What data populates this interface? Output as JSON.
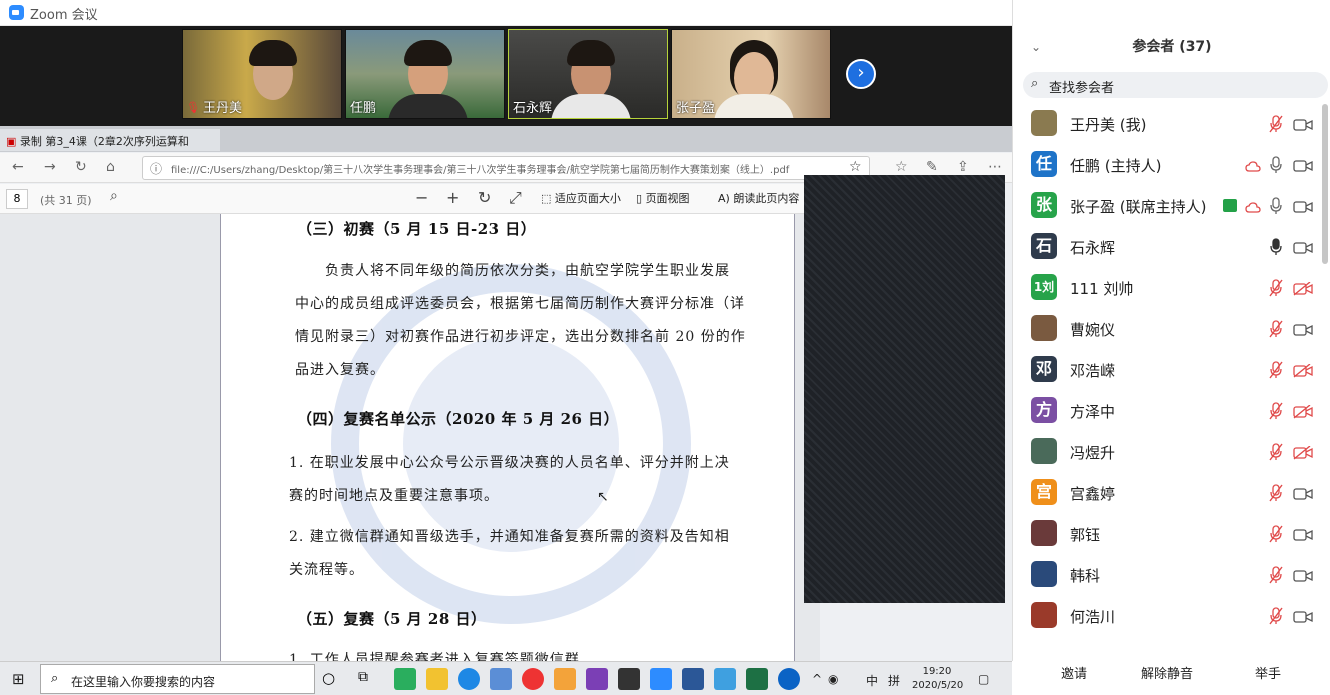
{
  "window": {
    "title": "Zoom 会议"
  },
  "videos": [
    {
      "name": "王丹美",
      "muted": true
    },
    {
      "name": "任鹏",
      "muted": false
    },
    {
      "name": "石永辉",
      "muted": false
    },
    {
      "name": "张子盈",
      "muted": false
    }
  ],
  "browser": {
    "tab_label": "第3_4课（2章2次序列运算和",
    "recording_label": "录制",
    "url": "file:///C:/Users/zhang/Desktop/第三十八次学生事务理事会/第三十八次学生事务理事会/航空学院第七届简历制作大赛策划案（线上）.pdf",
    "page_number": "8",
    "page_total": "(共 31 页)",
    "fit_page": "适应页面大小",
    "page_view": "页面视图",
    "read_aloud": "朗读此页内容"
  },
  "doc": {
    "h3": "（三）初赛（5 月 15 日-23 日）",
    "p3_lines": [
      "负责人将不同年级的简历依次分类，由航空学院学生职业发展",
      "中心的成员组成评选委员会，根据第七届简历制作大赛评分标准（详",
      "情见附录三）对初赛作品进行初步评定，选出分数排名前 20 份的作",
      "品进入复赛。"
    ],
    "h4": "（四）复赛名单公示（2020 年 5 月 26 日）",
    "p4a_lines": [
      "1.  在职业发展中心公众号公示晋级决赛的人员名单、评分并附上决",
      "赛的时间地点及重要注意事项。"
    ],
    "p4b_lines": [
      "2.  建立微信群通知晋级选手，并通知准备复赛所需的资料及告知相",
      "关流程等。"
    ],
    "h5": "（五）复赛（5 月 28 日）",
    "p5": "1.  工作人员提醒参赛者进入复赛签题微信群"
  },
  "panel": {
    "title": "参会者",
    "count": "(37)",
    "search_placeholder": "查找参会者",
    "participants": [
      {
        "name": "王丹美 (我)",
        "avatar": "",
        "color": "#8a7a50",
        "mic": "muted",
        "cam": "on"
      },
      {
        "name": "任鹏 (主持人)",
        "avatar": "任",
        "color": "#1e73c8",
        "mic": "on",
        "cam": "on",
        "cloud": true
      },
      {
        "name": "张子盈 (联席主持人)",
        "avatar": "张",
        "color": "#27a34a",
        "mic": "on",
        "cam": "on",
        "cloud": true,
        "share": true
      },
      {
        "name": "石永辉",
        "avatar": "石",
        "color": "#2f3b4c",
        "mic": "on-dark",
        "cam": "on"
      },
      {
        "name": "111 刘帅",
        "avatar": "1刘",
        "color": "#27a34a",
        "mic": "muted",
        "cam": "off"
      },
      {
        "name": "曹婉仪",
        "avatar": "",
        "color": "#7a5a40",
        "mic": "muted",
        "cam": "on"
      },
      {
        "name": "邓浩嵘",
        "avatar": "邓",
        "color": "#2f3b4c",
        "mic": "muted",
        "cam": "off"
      },
      {
        "name": "方泽中",
        "avatar": "方",
        "color": "#7b4fa3",
        "mic": "muted",
        "cam": "off"
      },
      {
        "name": "冯煜升",
        "avatar": "",
        "color": "#4a6a5a",
        "mic": "muted",
        "cam": "off"
      },
      {
        "name": "宫鑫婷",
        "avatar": "宫",
        "color": "#ef8f1a",
        "mic": "muted",
        "cam": "on"
      },
      {
        "name": "郭钰",
        "avatar": "",
        "color": "#6a3a3a",
        "mic": "muted",
        "cam": "on"
      },
      {
        "name": "韩科",
        "avatar": "",
        "color": "#2a4a7a",
        "mic": "muted",
        "cam": "on"
      },
      {
        "name": "何浩川",
        "avatar": "",
        "color": "#9a3a2a",
        "mic": "muted",
        "cam": "on"
      }
    ],
    "footer": {
      "invite": "邀请",
      "unmute_all": "解除静音",
      "raise_hand": "举手"
    }
  },
  "taskbar": {
    "search_placeholder": "在这里输入你要搜索的内容",
    "ime": "中",
    "ime2": "拼",
    "time": "19:20",
    "date": "2020/5/20"
  }
}
